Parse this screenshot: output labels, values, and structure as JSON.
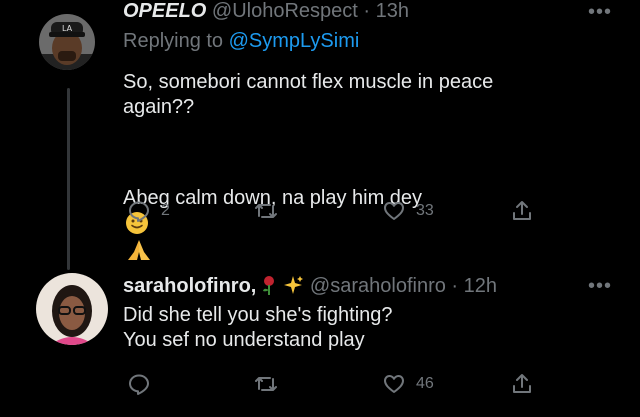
{
  "tweet1": {
    "display_name": "OPEELO",
    "handle": "@UlohoRespect",
    "sep": "·",
    "time": "13h",
    "replying_prefix": "Replying to",
    "replying_handle": "@SympLySimi",
    "text": "So, somebori cannot flex muscle in peace\nagain??",
    "text2": "Abeg calm down, na play him dey",
    "emojis": [
      "slightly-smiling-face",
      "folded-hands"
    ],
    "actions": {
      "reply_count": "2",
      "retweet_count": "",
      "like_count": "33"
    }
  },
  "tweet2": {
    "display_name": "saraholofinro,",
    "name_emojis": [
      "rose",
      "sparkles"
    ],
    "handle": "@saraholofinro",
    "sep": "·",
    "time": "12h",
    "text": "Did she tell you she's fighting?\nYou sef no understand play",
    "actions": {
      "reply_count": "",
      "retweet_count": "",
      "like_count": "46"
    }
  },
  "more_label": "•••",
  "colors": {
    "background": "#000000",
    "text": "#e7e9ea",
    "muted": "#71767b",
    "link": "#1d9bf0"
  }
}
